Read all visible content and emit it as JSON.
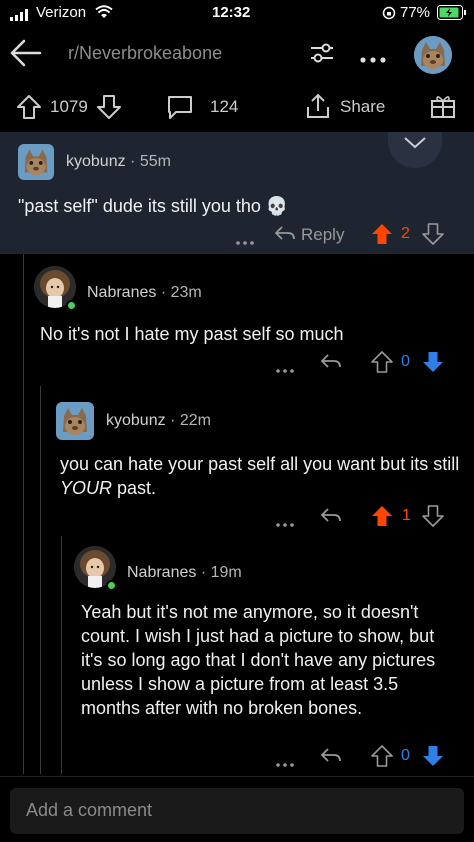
{
  "status": {
    "carrier": "Verizon",
    "time": "12:32",
    "battery": "77%"
  },
  "header": {
    "subreddit": "r/Neverbrokeabone"
  },
  "post_actions": {
    "upvotes": "1079",
    "comments": "124",
    "share": "Share"
  },
  "comments": [
    {
      "user": "kyobunz",
      "age": "55m",
      "text": "\"past self\" dude its still you tho 💀",
      "reply_label": "Reply",
      "score": "2",
      "vote": "up"
    },
    {
      "user": "Nabranes",
      "age": "23m",
      "text": "No it's not I hate my past self so much",
      "score": "0",
      "vote": "down"
    },
    {
      "user": "kyobunz",
      "age": "22m",
      "text_before": "you can hate your past self all you want but its still ",
      "text_emph": "YOUR",
      "text_after": " past.",
      "score": "1",
      "vote": "up"
    },
    {
      "user": "Nabranes",
      "age": "19m",
      "text": "Yeah but it's not me anymore, so it doesn't count. I wish I just had a picture to show, but it's so long ago that I don't have any pictures unless I show a picture from at least 3.5 months after with no broken bones.",
      "score": "0",
      "vote": "down"
    }
  ],
  "composer": {
    "placeholder": "Add a comment"
  },
  "colors": {
    "upvote": "#ff4500",
    "downvote": "#2f7fe8",
    "highlight_bg": "#1f2530"
  }
}
